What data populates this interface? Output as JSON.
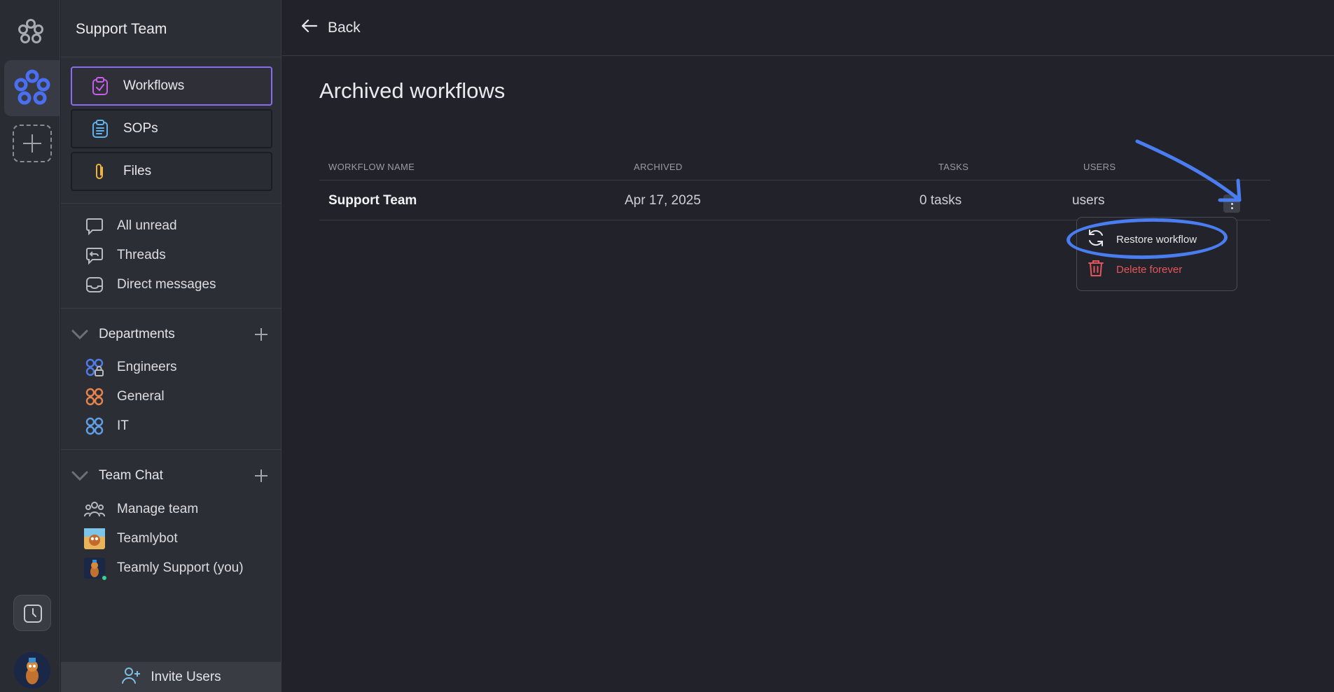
{
  "sidebar": {
    "title": "Support Team",
    "nav": [
      {
        "label": "Workflows",
        "icon": "clipboard-check-icon",
        "active": true
      },
      {
        "label": "SOPs",
        "icon": "list-document-icon",
        "active": false
      },
      {
        "label": "Files",
        "icon": "paperclip-icon",
        "active": false
      }
    ],
    "inbox": [
      {
        "label": "All unread",
        "icon": "chat-bubble-icon"
      },
      {
        "label": "Threads",
        "icon": "reply-bubble-icon"
      },
      {
        "label": "Direct messages",
        "icon": "inbox-tray-icon"
      }
    ],
    "departments": {
      "label": "Departments",
      "items": [
        {
          "label": "Engineers",
          "icon": "group-locked-icon",
          "color": "#4f7ce8"
        },
        {
          "label": "General",
          "icon": "group-icon",
          "color": "#e8844c"
        },
        {
          "label": "IT",
          "icon": "group-icon",
          "color": "#5fa0e8"
        }
      ]
    },
    "team_chat": {
      "label": "Team Chat",
      "items": [
        {
          "label": "Manage team",
          "icon": "people-icon"
        },
        {
          "label": "Teamlybot",
          "icon": "bot-avatar"
        },
        {
          "label": "Teamly Support (you)",
          "icon": "user-avatar"
        }
      ]
    },
    "invite_label": "Invite Users"
  },
  "topbar": {
    "back_label": "Back"
  },
  "main": {
    "title": "Archived workflows",
    "columns": [
      "WORKFLOW NAME",
      "ARCHIVED",
      "TASKS",
      "USERS"
    ],
    "rows": [
      {
        "name": "Support Team",
        "archived": "Apr 17, 2025",
        "tasks": "0 tasks",
        "users": "users"
      }
    ]
  },
  "context_menu": {
    "restore_label": "Restore workflow",
    "delete_label": "Delete forever"
  },
  "colors": {
    "accent": "#4a7ef0",
    "active_border": "#8a6cf0",
    "danger": "#e5555a",
    "background": "#22232a"
  }
}
